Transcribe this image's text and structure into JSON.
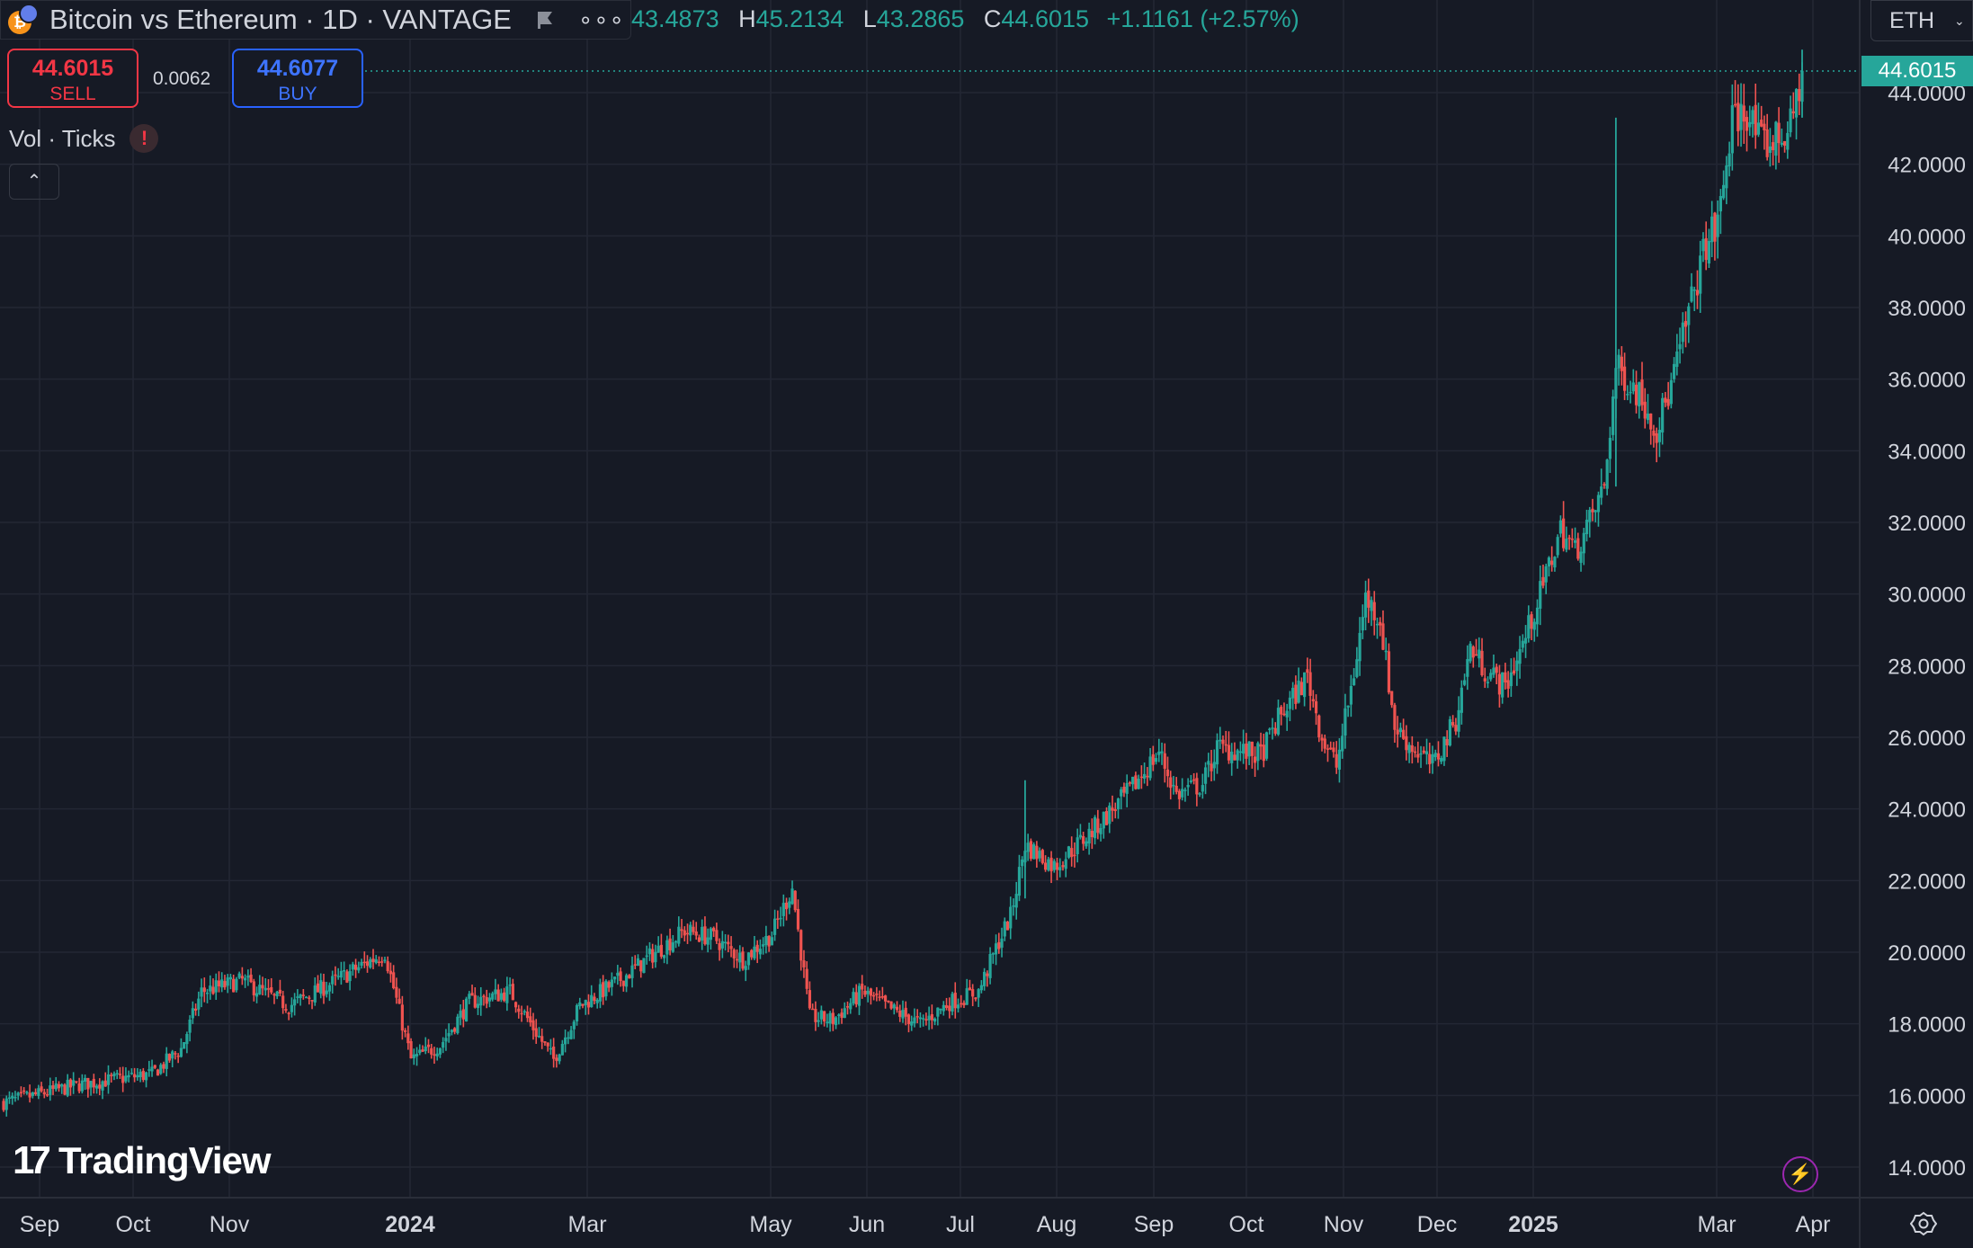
{
  "header": {
    "title": "Bitcoin vs Ethereum · 1D · VANTAGE",
    "ohlc": {
      "open_value": "43.4873",
      "high_key": "H",
      "high_value": "45.2134",
      "low_key": "L",
      "low_value": "43.2865",
      "close_key": "C",
      "close_value": "44.6015",
      "change": "+1.1161 (+2.57%)"
    }
  },
  "trade": {
    "sell_price": "44.6015",
    "sell_label": "SELL",
    "spread": "0.0062",
    "buy_price": "44.6077",
    "buy_label": "BUY"
  },
  "indicator": {
    "label": "Vol · Ticks",
    "warning": "!"
  },
  "collapse_glyph": "⌃",
  "symbol": {
    "label": "ETH",
    "chevron": "⌄"
  },
  "last_price_tag": "44.6015",
  "logo": {
    "word": "TradingView"
  },
  "colors": {
    "up": "#26a69a",
    "down": "#ef5350",
    "background": "#161a25",
    "grid": "#232734"
  },
  "chart_data": {
    "type": "candlestick",
    "y_axis_ticks": [
      "44.0000",
      "42.0000",
      "40.0000",
      "38.0000",
      "36.0000",
      "34.0000",
      "32.0000",
      "30.0000",
      "28.0000",
      "26.0000",
      "24.0000",
      "22.0000",
      "20.0000",
      "18.0000",
      "16.0000",
      "14.0000"
    ],
    "x_axis_ticks": [
      {
        "label": "Sep",
        "bold": false
      },
      {
        "label": "Oct",
        "bold": false
      },
      {
        "label": "Nov",
        "bold": false
      },
      {
        "label": "2024",
        "bold": true
      },
      {
        "label": "Mar",
        "bold": false
      },
      {
        "label": "May",
        "bold": false
      },
      {
        "label": "Jun",
        "bold": false
      },
      {
        "label": "Jul",
        "bold": false
      },
      {
        "label": "Aug",
        "bold": false
      },
      {
        "label": "Sep",
        "bold": false
      },
      {
        "label": "Oct",
        "bold": false
      },
      {
        "label": "Nov",
        "bold": false
      },
      {
        "label": "Dec",
        "bold": false
      },
      {
        "label": "2025",
        "bold": true
      },
      {
        "label": "Mar",
        "bold": false
      },
      {
        "label": "Apr",
        "bold": false
      }
    ],
    "y_range": [
      13.2,
      46.8
    ],
    "last_price": 44.6015,
    "trend_points": [
      {
        "date": "2023-08-25",
        "close": 15.8
      },
      {
        "date": "2023-09-20",
        "close": 16.3
      },
      {
        "date": "2023-10-15",
        "close": 16.6
      },
      {
        "date": "2023-10-25",
        "close": 17.3
      },
      {
        "date": "2023-11-01",
        "close": 18.9
      },
      {
        "date": "2023-11-15",
        "close": 19.2
      },
      {
        "date": "2023-12-01",
        "close": 18.5
      },
      {
        "date": "2023-12-15",
        "close": 19.1
      },
      {
        "date": "2024-01-03",
        "close": 20.0
      },
      {
        "date": "2024-01-12",
        "close": 17.0
      },
      {
        "date": "2024-01-22",
        "close": 17.4
      },
      {
        "date": "2024-02-01",
        "close": 18.6
      },
      {
        "date": "2024-02-15",
        "close": 18.9
      },
      {
        "date": "2024-03-01",
        "close": 17.0
      },
      {
        "date": "2024-03-10",
        "close": 18.5
      },
      {
        "date": "2024-03-25",
        "close": 19.3
      },
      {
        "date": "2024-04-05",
        "close": 20.0
      },
      {
        "date": "2024-04-15",
        "close": 20.6
      },
      {
        "date": "2024-04-25",
        "close": 20.4
      },
      {
        "date": "2024-05-05",
        "close": 19.8
      },
      {
        "date": "2024-05-15",
        "close": 20.5
      },
      {
        "date": "2024-05-22",
        "close": 21.8
      },
      {
        "date": "2024-05-28",
        "close": 18.2
      },
      {
        "date": "2024-06-05",
        "close": 18.1
      },
      {
        "date": "2024-06-15",
        "close": 18.9
      },
      {
        "date": "2024-06-25",
        "close": 18.4
      },
      {
        "date": "2024-07-05",
        "close": 18.0
      },
      {
        "date": "2024-07-15",
        "close": 18.6
      },
      {
        "date": "2024-07-25",
        "close": 18.9
      },
      {
        "date": "2024-08-01",
        "close": 20.3
      },
      {
        "date": "2024-08-05",
        "close": 21.0
      },
      {
        "date": "2024-08-10",
        "close": 23.0
      },
      {
        "date": "2024-08-20",
        "close": 22.4
      },
      {
        "date": "2024-09-01",
        "close": 23.3
      },
      {
        "date": "2024-09-15",
        "close": 24.5
      },
      {
        "date": "2024-09-25",
        "close": 25.6
      },
      {
        "date": "2024-10-01",
        "close": 24.4
      },
      {
        "date": "2024-10-10",
        "close": 24.7
      },
      {
        "date": "2024-10-15",
        "close": 25.7
      },
      {
        "date": "2024-10-30",
        "close": 25.5
      },
      {
        "date": "2024-11-05",
        "close": 26.5
      },
      {
        "date": "2024-11-15",
        "close": 27.7
      },
      {
        "date": "2024-11-20",
        "close": 26.0
      },
      {
        "date": "2024-11-25",
        "close": 25.2
      },
      {
        "date": "2024-12-01",
        "close": 27.8
      },
      {
        "date": "2024-12-05",
        "close": 29.9
      },
      {
        "date": "2024-12-10",
        "close": 29.3
      },
      {
        "date": "2024-12-15",
        "close": 26.3
      },
      {
        "date": "2024-12-20",
        "close": 25.8
      },
      {
        "date": "2024-12-28",
        "close": 25.2
      },
      {
        "date": "2025-01-05",
        "close": 26.5
      },
      {
        "date": "2025-01-10",
        "close": 28.5
      },
      {
        "date": "2025-01-15",
        "close": 27.9
      },
      {
        "date": "2025-01-22",
        "close": 27.4
      },
      {
        "date": "2025-01-28",
        "close": 28.6
      },
      {
        "date": "2025-02-03",
        "close": 30.0
      },
      {
        "date": "2025-02-10",
        "close": 31.8
      },
      {
        "date": "2025-02-15",
        "close": 31.2
      },
      {
        "date": "2025-02-20",
        "close": 32.0
      },
      {
        "date": "2025-02-25",
        "close": 33.0
      },
      {
        "date": "2025-03-01",
        "close": 36.3
      },
      {
        "date": "2025-03-05",
        "close": 36.0
      },
      {
        "date": "2025-03-10",
        "close": 35.5
      },
      {
        "date": "2025-03-15",
        "close": 34.6
      },
      {
        "date": "2025-03-20",
        "close": 35.8
      },
      {
        "date": "2025-03-25",
        "close": 37.5
      },
      {
        "date": "2025-04-01",
        "close": 39.8
      },
      {
        "date": "2025-04-05",
        "close": 40.3
      },
      {
        "date": "2025-04-10",
        "close": 43.2
      },
      {
        "date": "2025-04-15",
        "close": 43.5
      },
      {
        "date": "2025-04-20",
        "close": 42.5
      },
      {
        "date": "2025-04-25",
        "close": 42.7
      },
      {
        "date": "2025-04-30",
        "close": 43.0
      },
      {
        "date": "2025-05-04",
        "close": 44.6
      }
    ]
  }
}
